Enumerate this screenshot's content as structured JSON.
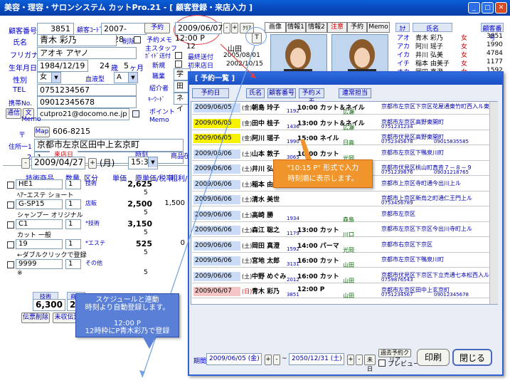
{
  "window": {
    "title": "美容・理容・サロンシステム カットPro.21 - [ 顧客登録・来店入力 ]"
  },
  "customer": {
    "id_label": "顧客番号",
    "id": "3851",
    "code_label": "顧客ｺｰﾄﾞ",
    "code": "2007-0128",
    "name_label": "氏名",
    "name": "青木 彩乃",
    "delete_label": "削除",
    "kana_label": "フリガナ",
    "kana": "アオキ アヤノ",
    "birth_label": "生年月日",
    "birth": "1984/12/19",
    "age": "24",
    "age_unit": "歳",
    "months": "5",
    "months_unit": "ヶ月",
    "gender_label": "性別",
    "gender": "女",
    "blood_label": "血液型",
    "blood": "A",
    "tel_label": "TEL",
    "tel": "0751234567",
    "mobile_label": "携帯No.",
    "mobile": "09012345678",
    "mail_btn": "通信",
    "mail_btn2": "文",
    "email": "cutpro21@docomo.ne.jp",
    "zip_label": "〒",
    "map_btn": "Map",
    "zip": "606-8215",
    "addr_label": "住所一1",
    "addr1": "京都市左京区田中上玄京町",
    "addr2_label": "2",
    "addr2": "1－2－3",
    "memo_label": "Memo"
  },
  "reserve_panel": {
    "yoyaku_btn": "予約",
    "date": "2009/06/07",
    "plus": "+",
    "minus": "-",
    "clear": "ｸﾘｱ",
    "memo_label": "予約メモ",
    "time": "12:00 P",
    "staff_label": "主スタッフ",
    "staff_val": "12",
    "staff_name": "山田",
    "dm_label": "ｶﾞｲﾄﾞ送付",
    "last_label": "最終送付",
    "last_date": "2005/08/01",
    "new_label": "新規",
    "first_label": "初来店日",
    "first_date": "2002/10/15",
    "job_label": "職業",
    "job_val": "学生",
    "intro_label": "紹介者",
    "intro_val": "田中",
    "keyword_label": "ｷｰﾜｰﾄﾞ",
    "keyword_val": "ネイ",
    "point_label": "ポイント",
    "memo2_label": "Memo",
    "t_btn": "T"
  },
  "tabs": [
    "画像",
    "情報1",
    "情報2",
    "注意",
    "予約",
    "Memo"
  ],
  "visit": {
    "date_label": "来店日",
    "date": "2009/04/27",
    "dow": "(月)",
    "time_label": "時刻",
    "time": "15:30",
    "product_label": "商品在"
  },
  "items_header": {
    "tech": "技術商品",
    "qty": "数量",
    "kubun": "区分",
    "price": "単価",
    "cost": "原単価/税率",
    "profit": "粗利/"
  },
  "items": [
    {
      "code": "HE1",
      "qty": "1",
      "kubun": "技術",
      "price": "2,625",
      "name": "ﾍｱｰエステ ショート",
      "sub": "5"
    },
    {
      "code": "G-SP15",
      "qty": "1",
      "kubun": "店販",
      "price": "2,500",
      "cost": "1,500",
      "name": "シャンプー オリジナル",
      "sub": "5"
    },
    {
      "code": "C1",
      "qty": "1",
      "kubun": "*技術",
      "price": "3,150",
      "name": "カット 一般",
      "sub": "5"
    },
    {
      "code": "19",
      "qty": "1",
      "kubun": "*エステ",
      "price": "525",
      "cost": "0",
      "name": "←ダブルクリックで登録",
      "sub": "5"
    },
    {
      "code": "9999",
      "qty": "1",
      "kubun": "その他",
      "price": "",
      "name": "※",
      "sub": "5"
    }
  ],
  "totals": {
    "tech_label": "技術",
    "tech": "6,300",
    "goods_label": "商品",
    "goods": "2",
    "delete_btn": "伝票削除",
    "unpaid_btn": "未収伝票一"
  },
  "customer_list": {
    "headers": [
      "ｶﾅ",
      "氏名",
      "",
      "顧客番号"
    ],
    "rows": [
      {
        "k": "アオ",
        "name": "青木 彩乃",
        "g": "女",
        "no": "3851"
      },
      {
        "k": "アカ",
        "name": "阿川 瑶子",
        "g": "女",
        "no": "1990"
      },
      {
        "k": "イカ",
        "name": "井川 弘美",
        "g": "女",
        "no": "4784"
      },
      {
        "k": "イチ",
        "name": "稲本 由美子",
        "g": "女",
        "no": "1177"
      },
      {
        "k": "オカ",
        "name": "岡田 真澄",
        "g": "女",
        "no": "1592"
      },
      {
        "k": "",
        "name": "相島 玲子",
        "g": "女",
        "no": "1192"
      }
    ]
  },
  "dialog": {
    "title": "[ 予約一覧 ]",
    "buttons": [
      "予約日",
      "氏名",
      "顧客番号",
      "予約メモ",
      "連常担当"
    ],
    "rows": [
      {
        "date": "2009/06/05",
        "dow": "(金)",
        "name": "朝島 玲子",
        "no": "1192",
        "time": "10:00 カット＆ネイル",
        "staff": "広瀬",
        "addr": "京都市左京区下京区花屋通東竹町西入ル東",
        "p1": "",
        "p2": "",
        "hl": "blue"
      },
      {
        "date": "2009/06/05",
        "dow": "(金)",
        "name": "田中 桂子",
        "no": "1436",
        "time": "13:00 カット＆ネイル",
        "staff": "広瀬",
        "addr": "京都市左京区高野東開町",
        "p1": "0751231234",
        "p2": "",
        "hl": "yellow"
      },
      {
        "date": "2009/06/05",
        "dow": "(金)",
        "name": "阿川 瑶子",
        "no": "1990",
        "time": "15:00 ネイル",
        "staff": "日高",
        "addr": "京都市伏見区高野東開町",
        "p1": "0752345678",
        "p2": "09015835585",
        "hl": "yellow"
      },
      {
        "date": "2009/06/06",
        "dow": "(土)",
        "name": "山本 敦子",
        "no": "3065",
        "time": "10:00 カット",
        "staff": "光岡",
        "addr": "京都市左京区下鴨泉川町",
        "p1": "",
        "p2": "",
        "hl": "blue"
      },
      {
        "date": "2009/06/06",
        "dow": "(土)",
        "name": "井川 弘美",
        "no": "4784",
        "time": "10:00 カット",
        "staff": "",
        "addr": "京都市伏見区桃山町真斉７－８－９",
        "p1": "0751239876",
        "p2": "09031218765",
        "hl": "blue"
      },
      {
        "date": "2009/06/06",
        "dow": "(土)",
        "name": "稲本 由美",
        "no": "",
        "time": "",
        "staff": "",
        "addr": "京都市上京区寺町通今出川上ル",
        "p1": "",
        "p2": "",
        "hl": "blue"
      },
      {
        "date": "2009/06/06",
        "dow": "(土)",
        "name": "清水 美世",
        "no": "",
        "time": "",
        "staff": "",
        "addr": "京都市上京区新烏之町通仁王門上ル",
        "p1": "0753456789",
        "p2": "",
        "hl": "blue"
      },
      {
        "date": "2009/06/06",
        "dow": "(土)",
        "name": "高崎 勝",
        "no": "1934",
        "time": "",
        "staff": "森島",
        "addr": "京都市左京区",
        "p1": "",
        "p2": "",
        "hl": "blue"
      },
      {
        "date": "2009/06/06",
        "dow": "(土)",
        "name": "森江 聡之",
        "no": "1179",
        "time": "13:00 カット",
        "staff": "川口",
        "addr": "京都市左京区下京区今出川寺町上ル",
        "p1": "",
        "p2": "",
        "hl": "blue"
      },
      {
        "date": "2009/06/06",
        "dow": "(土)",
        "name": "岡田 真澄",
        "no": "1592",
        "time": "14:00 パーマ",
        "staff": "光岡",
        "addr": "京都市右京区下京区",
        "p1": "",
        "p2": "",
        "hl": "blue"
      },
      {
        "date": "2009/06/06",
        "dow": "(土)",
        "name": "宮地 太郎",
        "no": "3131",
        "time": "16:00 カット",
        "staff": "山田",
        "addr": "京都市左京区下鴨泉川町",
        "p1": "",
        "p2": "",
        "hl": "blue"
      },
      {
        "date": "2009/06/06",
        "dow": "(土)",
        "name": "中野 めぐみ",
        "no": "2012",
        "time": "16:00 カット",
        "staff": "山田",
        "addr": "京都市伏見区下京区下立売通七本松西入ル",
        "p1": "0759876543",
        "p2": "",
        "hl": "blue"
      },
      {
        "date": "2009/06/07",
        "dow": "(日)",
        "name": "青木 彩乃",
        "no": "3851",
        "time": "12:00 P",
        "staff": "山田",
        "addr": "京都市左京区田中上玄京町",
        "p1": "0751234567",
        "p2": "09012345678",
        "hl": "pink"
      }
    ],
    "period_label": "期間",
    "period_from": "2009/06/05 (金)",
    "tilde": "~",
    "period_to": "2050/12/31 (土)",
    "prev_btn": "未日",
    "past_label": "過去予約クリア",
    "preview_label": "プレビュー",
    "print_btn": "印刷",
    "close_btn": "閉じる"
  },
  "callouts": {
    "orange": "\"10:15 P\" 形式で入力\n時刻順に表示します。",
    "blue": "スケジュールと連動\n時刻より自動登録します。\n\n12:00 P\n12時枠にP青木彩乃で登録"
  }
}
